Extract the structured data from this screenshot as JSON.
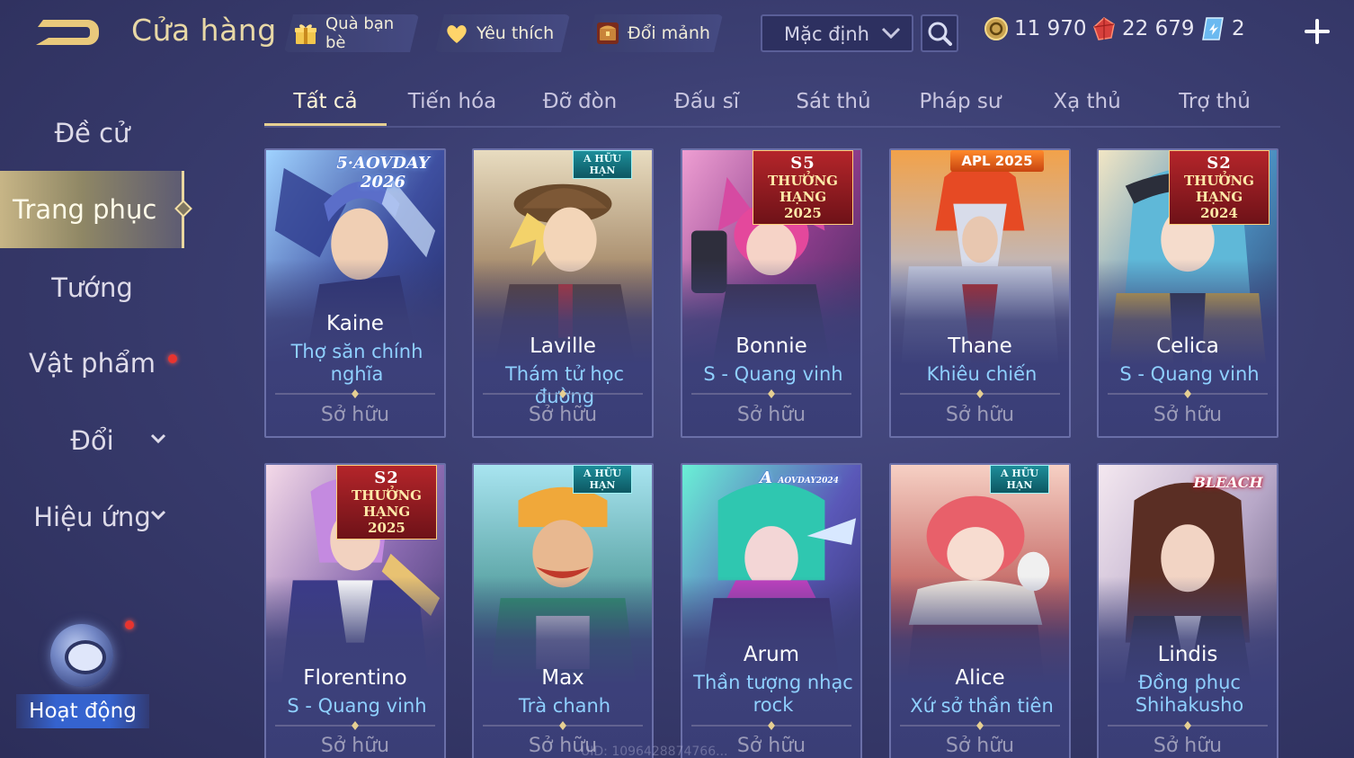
{
  "header": {
    "title": "Cửa hàng",
    "chips": {
      "friend_gift": "Quà bạn bè",
      "favorites": "Yêu thích",
      "shard_exchange": "Đổi mảnh"
    },
    "sort": {
      "selected": "Mặc định"
    },
    "currency": {
      "gold": "11 970",
      "gems": "22 679",
      "vouchers": "2"
    }
  },
  "sidebar": {
    "items": [
      {
        "label": "Đề cử"
      },
      {
        "label": "Trang phục"
      },
      {
        "label": "Tướng"
      },
      {
        "label": "Vật phẩm"
      },
      {
        "label": "Đổi"
      },
      {
        "label": "Hiệu ứng"
      }
    ],
    "activity_label": "Hoạt động"
  },
  "tabs": [
    "Tất cả",
    "Tiến hóa",
    "Đỡ đòn",
    "Đấu sĩ",
    "Sát thủ",
    "Pháp sư",
    "Xạ thủ",
    "Trợ thủ"
  ],
  "active_tab": "Tất cả",
  "cards": [
    {
      "hero": "Kaine",
      "skin": "Thợ săn chính nghĩa",
      "status": "Sở hữu",
      "badge": "5·AOVDAY 2026",
      "badge_top": "",
      "badge_bottom": ""
    },
    {
      "hero": "Laville",
      "skin": "Thám tử học đường",
      "status": "Sở hữu",
      "badge": "A",
      "badge_top": "HỮU HẠN",
      "badge_bottom": ""
    },
    {
      "hero": "Bonnie",
      "skin": "S - Quang vinh",
      "status": "Sở hữu",
      "badge": "S5",
      "badge_top": "THƯỞNG HẠNG",
      "badge_bottom": "2025"
    },
    {
      "hero": "Thane",
      "skin": "Khiêu chiến",
      "status": "Sở hữu",
      "badge": "APL 2025",
      "badge_top": "",
      "badge_bottom": ""
    },
    {
      "hero": "Celica",
      "skin": "S - Quang vinh",
      "status": "Sở hữu",
      "badge": "S2",
      "badge_top": "THƯỞNG HẠNG",
      "badge_bottom": "2024"
    },
    {
      "hero": "Florentino",
      "skin": "S - Quang vinh",
      "status": "Sở hữu",
      "badge": "S2",
      "badge_top": "THƯỞNG HẠNG",
      "badge_bottom": "2025"
    },
    {
      "hero": "Max",
      "skin": "Trà chanh",
      "status": "Sở hữu",
      "badge": "A",
      "badge_top": "HỮU HẠN",
      "badge_bottom": ""
    },
    {
      "hero": "Arum",
      "skin": "Thần tượng nhạc rock",
      "status": "Sở hữu",
      "badge": "A",
      "badge_top": "AOVDAY2024",
      "badge_bottom": ""
    },
    {
      "hero": "Alice",
      "skin": "Xứ sở thần tiên",
      "status": "Sở hữu",
      "badge": "A",
      "badge_top": "HỮU HẠN",
      "badge_bottom": ""
    },
    {
      "hero": "Lindis",
      "skin": "Đồng phục Shihakusho",
      "status": "Sở hữu",
      "badge": "BLEACH",
      "badge_top": "",
      "badge_bottom": ""
    }
  ],
  "footer": {
    "uid": "UID: 1096428874766..."
  },
  "colors": {
    "accent_gold": "#e6cf92",
    "skin_name_blue": "#8fd0ff",
    "background": "#3a3d70",
    "notification_red": "#e8342f"
  },
  "icons": [
    "back-arrow-icon",
    "gift-icon",
    "heart-icon",
    "chest-icon",
    "chevron-down-icon",
    "search-icon",
    "gold-coin-icon",
    "red-gem-icon",
    "voucher-icon",
    "plus-icon"
  ]
}
